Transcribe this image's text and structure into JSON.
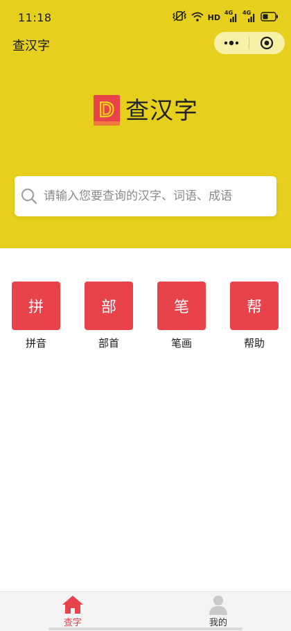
{
  "status_bar": {
    "time": "11:18",
    "icons": [
      "vibrate-icon",
      "wifi-icon",
      "hd-icon",
      "signal-4g-icon",
      "signal-4g-icon-2",
      "battery-icon"
    ],
    "hd_label": "HD",
    "network_label_1": "4G",
    "network_label_2": "4G"
  },
  "app_bar": {
    "title": "查汉字",
    "capsule_icons": [
      "more-dots-icon",
      "close-circle-icon"
    ]
  },
  "logo": {
    "mark_letter": "D",
    "text": "查汉字"
  },
  "search": {
    "placeholder": "请输入您要查询的汉字、词语、成语",
    "value": ""
  },
  "categories": [
    {
      "tile": "拼",
      "label": "拼音"
    },
    {
      "tile": "部",
      "label": "部首"
    },
    {
      "tile": "笔",
      "label": "笔画"
    },
    {
      "tile": "帮",
      "label": "帮助"
    }
  ],
  "tabbar": {
    "tabs": [
      {
        "label": "查字",
        "icon": "home-icon",
        "active": true
      },
      {
        "label": "我的",
        "icon": "user-icon",
        "active": false
      }
    ]
  },
  "colors": {
    "header_bg": "#e6cf1d",
    "accent_red": "#e8434a",
    "capsule_bg": "#f6f1a6"
  }
}
